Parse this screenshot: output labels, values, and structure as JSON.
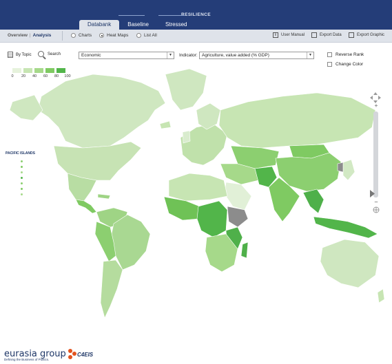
{
  "header": {
    "brand": "RESILIENCE",
    "tabs": [
      "Databank",
      "Baseline",
      "Stressed"
    ],
    "active_tab": "Databank"
  },
  "subbar": {
    "breadcrumb": [
      "Overview",
      "Analysis"
    ],
    "view_options": [
      "Charts",
      "Heat Maps",
      "List All"
    ],
    "selected_view": "Heat Maps",
    "tools": [
      "User Manual",
      "Export Data",
      "Export Graphic"
    ]
  },
  "controls": {
    "by_topic": "By Topic",
    "search": "Search",
    "category_select": "Economic",
    "indicator_label": "Indicator:",
    "indicator_select": "Agriculture, value added (% GDP)",
    "reverse_rank": "Reverse Rank",
    "change_color": "Change Color"
  },
  "legend": {
    "ticks": [
      "0",
      "20",
      "40",
      "60",
      "80",
      "100"
    ],
    "colors": [
      "#e6f2dc",
      "#c7e5b3",
      "#a6d98a",
      "#7fca62",
      "#52b54a",
      "#2f9a3c"
    ]
  },
  "pacific": {
    "label": "PACIFIC ISLANDS"
  },
  "footer": {
    "logo": "eurasia group",
    "tagline": "Defining the Business of Politics.",
    "partner": "C4EIS"
  },
  "colors": {
    "header_bg": "#243d78",
    "map_light": "#cfe7c0",
    "map_mid": "#9fd485",
    "map_dark": "#4fb04a",
    "no_data": "#8c8c8c"
  }
}
